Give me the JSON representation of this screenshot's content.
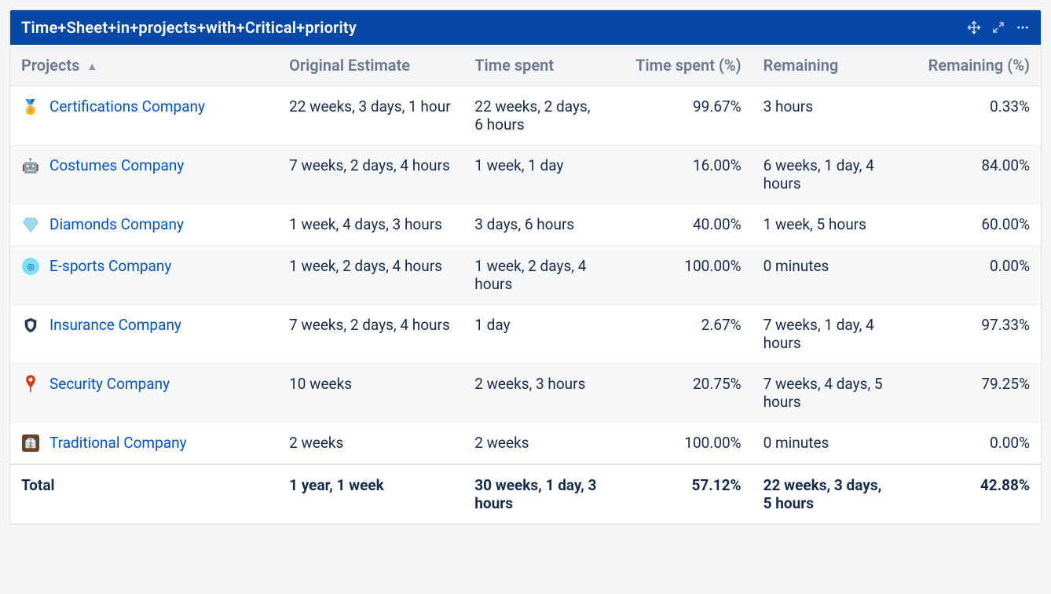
{
  "panel": {
    "title": "Time+Sheet+in+projects+with+Critical+priority"
  },
  "columns": [
    {
      "label": "Projects",
      "sorted": true
    },
    {
      "label": "Original Estimate"
    },
    {
      "label": "Time spent"
    },
    {
      "label": "Time spent (%)"
    },
    {
      "label": "Remaining"
    },
    {
      "label": "Remaining (%)"
    }
  ],
  "rows": [
    {
      "icon": "medal",
      "name": "Certifications Company",
      "original_estimate": "22 weeks, 3 days, 1 hour",
      "time_spent": "22 weeks, 2 days, 6 hours",
      "time_spent_pct": "99.67%",
      "remaining": "3 hours",
      "remaining_pct": "0.33%"
    },
    {
      "icon": "robot",
      "name": "Costumes Company",
      "original_estimate": "7 weeks, 2 days, 4 hours",
      "time_spent": "1 week, 1 day",
      "time_spent_pct": "16.00%",
      "remaining": "6 weeks, 1 day, 4 hours",
      "remaining_pct": "84.00%"
    },
    {
      "icon": "diamond",
      "name": "Diamonds Company",
      "original_estimate": "1 week, 4 days, 3 hours",
      "time_spent": "3 days, 6 hours",
      "time_spent_pct": "40.00%",
      "remaining": "1 week, 5 hours",
      "remaining_pct": "60.00%"
    },
    {
      "icon": "esports",
      "name": "E-sports Company",
      "original_estimate": "1 week, 2 days, 4 hours",
      "time_spent": "1 week, 2 days, 4 hours",
      "time_spent_pct": "100.00%",
      "remaining": "0 minutes",
      "remaining_pct": "0.00%"
    },
    {
      "icon": "shield",
      "name": "Insurance Company",
      "original_estimate": "7 weeks, 2 days, 4 hours",
      "time_spent": "1 day",
      "time_spent_pct": "2.67%",
      "remaining": "7 weeks, 1 day, 4 hours",
      "remaining_pct": "97.33%"
    },
    {
      "icon": "pin",
      "name": "Security Company",
      "original_estimate": "10 weeks",
      "time_spent": "2 weeks, 3 hours",
      "time_spent_pct": "20.75%",
      "remaining": "7 weeks, 4 days, 5 hours",
      "remaining_pct": "79.25%"
    },
    {
      "icon": "trad",
      "name": "Traditional Company",
      "original_estimate": "2 weeks",
      "time_spent": "2 weeks",
      "time_spent_pct": "100.00%",
      "remaining": "0 minutes",
      "remaining_pct": "0.00%"
    }
  ],
  "total": {
    "label": "Total",
    "original_estimate": "1 year, 1 week",
    "time_spent": "30 weeks, 1 day, 3 hours",
    "time_spent_pct": "57.12%",
    "remaining": "22 weeks, 3 days, 5 hours",
    "remaining_pct": "42.88%"
  }
}
